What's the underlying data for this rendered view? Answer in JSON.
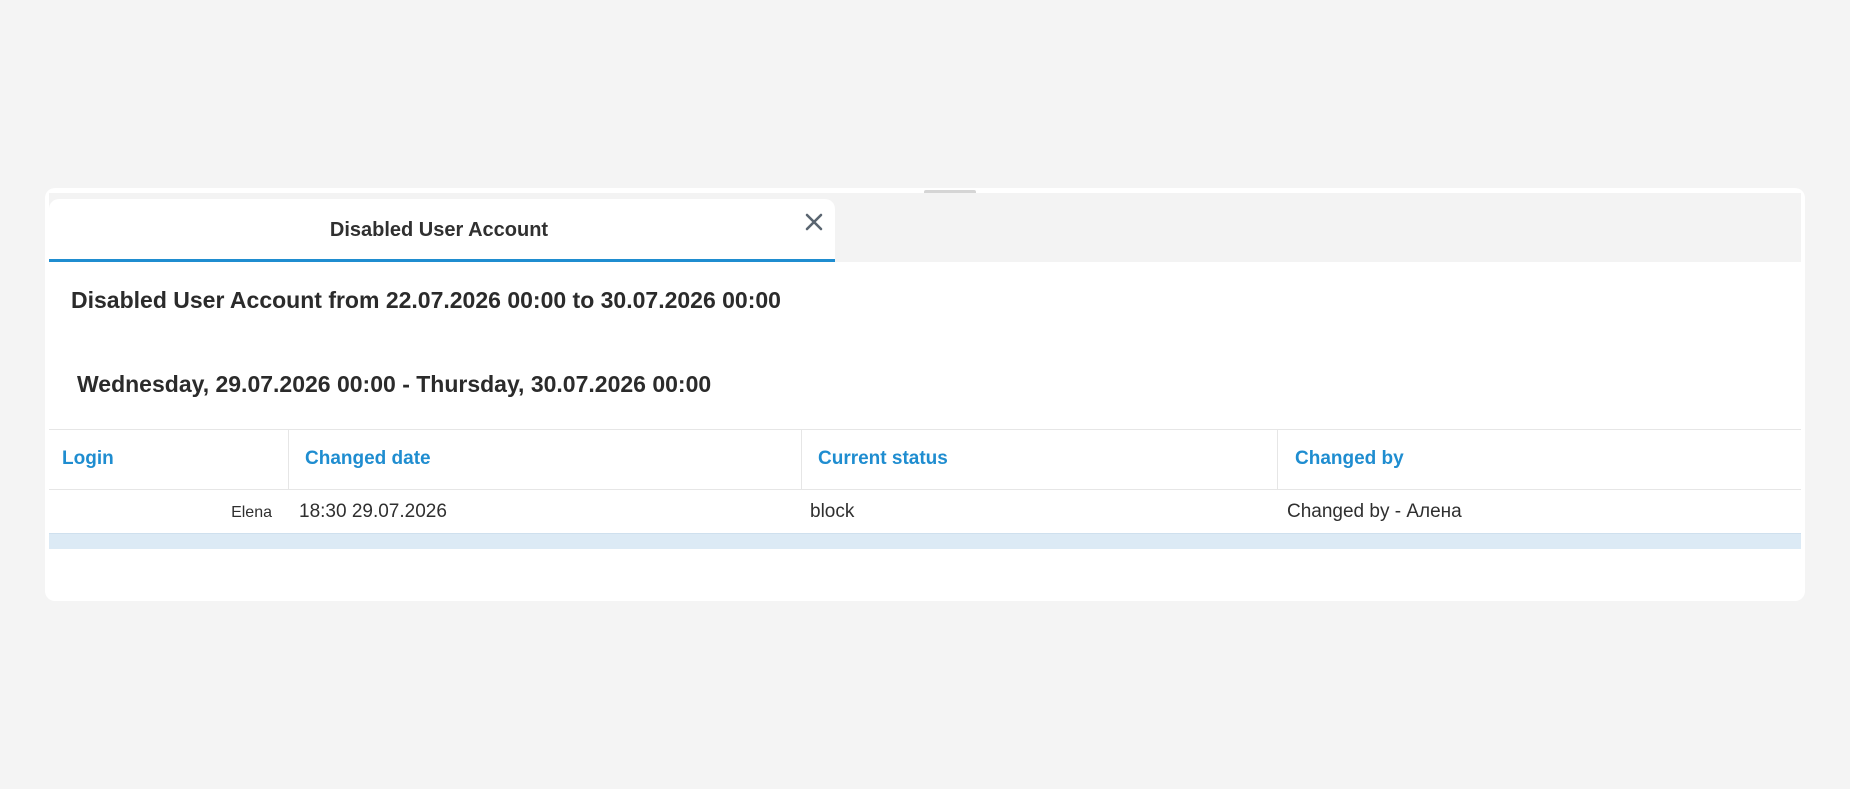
{
  "tab": {
    "title": "Disabled User Account",
    "close_icon": "close-icon"
  },
  "report": {
    "title": "Disabled User Account from 22.07.2026 00:00 to 30.07.2026 00:00",
    "period": "Wednesday, 29.07.2026 00:00 - Thursday, 30.07.2026 00:00"
  },
  "table": {
    "columns": [
      "Login",
      "Changed date",
      "Current status",
      "Changed by"
    ],
    "rows": [
      {
        "login": "Elena",
        "changed_date": "18:30 29.07.2026",
        "current_status": "block",
        "changed_by": "Changed by - Алена"
      }
    ]
  },
  "colors": {
    "accent": "#1f8dd0",
    "background": "#f4f4f4",
    "footer": "#dceaf5"
  }
}
